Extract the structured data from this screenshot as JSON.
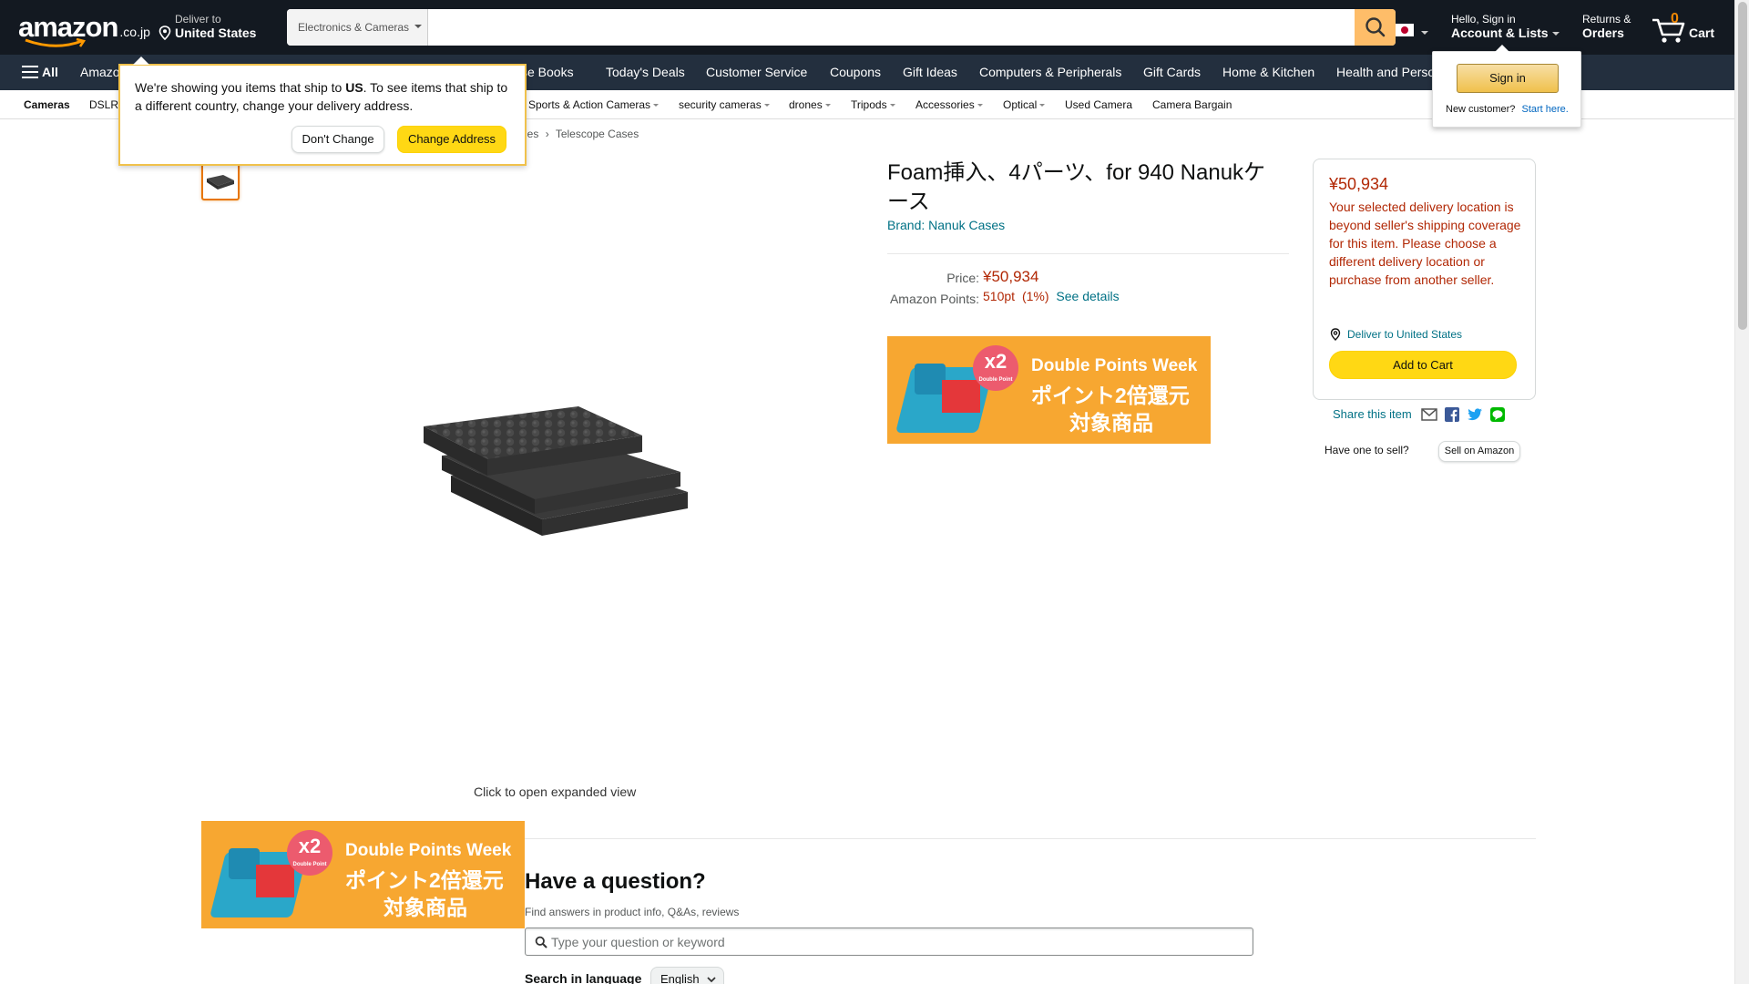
{
  "header": {
    "logo_word": "amazon",
    "logo_tld": ".co.jp",
    "deliver_line1": "Deliver to",
    "deliver_line2": "United States",
    "search_category": "Electronics & Cameras",
    "search_placeholder": "",
    "account_line1": "Hello, Sign in",
    "account_line2": "Account & Lists",
    "orders_line1": "Returns &",
    "orders_line2": "Orders",
    "cart_count": "0",
    "cart_label": "Cart",
    "brand_color": "#131921",
    "accent_color": "#febd69"
  },
  "nav_main": {
    "all_label": "All",
    "items": [
      "Amazon",
      "se Books",
      "Today's Deals",
      "Customer Service",
      "Coupons",
      "Gift Ideas",
      "Computers & Peripherals",
      "Gift Cards",
      "Home & Kitchen",
      "Health and Perso"
    ]
  },
  "nav_sub": {
    "items": [
      "Cameras",
      "DSLR",
      "Sports & Action Cameras",
      "security cameras",
      "drones",
      "Tripods",
      "Accessories",
      "Optical",
      "Used Camera",
      "Camera Bargain"
    ]
  },
  "breadcrumb": {
    "prev": "ies",
    "sep": "›",
    "current": "Telescope Cases"
  },
  "ship_popover": {
    "text_before": "We're showing you items that ship to ",
    "country": "US",
    "text_after": ". To see items that ship to a different country, change your delivery address.",
    "dont_change": "Don't Change",
    "change_address": "Change Address"
  },
  "signin_popover": {
    "button": "Sign in",
    "new_customer": "New customer?",
    "start_here": "Start here."
  },
  "product": {
    "title": "Foam挿入、4パーツ、for 940 Nanukケース",
    "brand": "Brand: Nanuk Cases",
    "price_label": "Price:",
    "price": "¥50,934",
    "points_label": "Amazon Points:",
    "points": "510pt",
    "points_pct": "(1%)",
    "see_details": "See details",
    "click_open": "Click to open expanded view"
  },
  "promo": {
    "badge": "x2",
    "badge_small": "Double Point",
    "line1": "Double Points Week",
    "line2": "ポイント2倍還元",
    "line3": "対象商品",
    "color": "#f7a731"
  },
  "buybox": {
    "price": "¥50,934",
    "warning": "Your selected delivery location is beyond seller's shipping coverage for this item. Please choose a different delivery location or purchase from another seller.",
    "deliver_to": "Deliver to United States",
    "add_to_cart": "Add to Cart",
    "share": "Share this item",
    "have_one": "Have one to sell?",
    "sell_on_amazon": "Sell on Amazon"
  },
  "questions": {
    "heading": "Have a question?",
    "sub": "Find answers in product info, Q&As, reviews",
    "placeholder": "Type your question or keyword",
    "lang_label": "Search in language",
    "lang_value": "English"
  }
}
